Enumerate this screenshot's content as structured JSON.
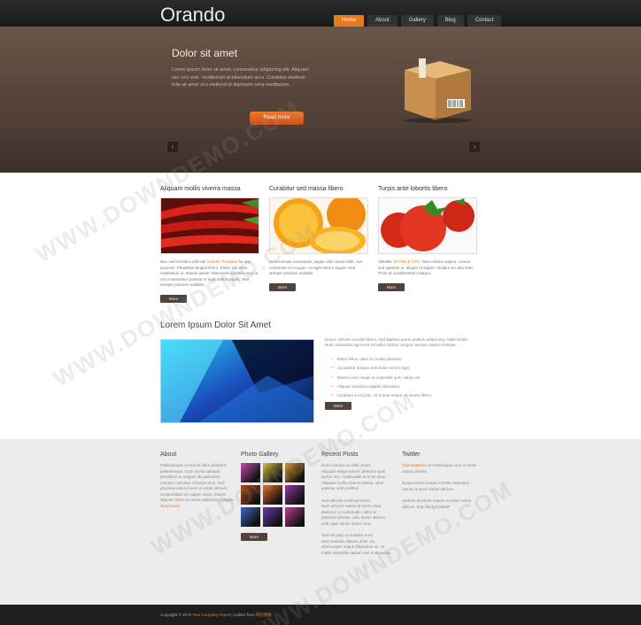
{
  "header": {
    "logo": "Orando",
    "nav": [
      "Home",
      "About",
      "Gallery",
      "Blog",
      "Contact"
    ],
    "active": "Home"
  },
  "hero": {
    "title": "Dolor sit amet",
    "text": "Lorem ipsum dolor sit amet, consectetur adipiscing elit. Aliquam nec orci erat. Vestibulum id bibendum arcu. Curabitur eleifend felis sit amet orci eleifend id dignissim urna vestibulum.",
    "button": "Read more",
    "prev": "‹",
    "next": "›"
  },
  "features": [
    {
      "title": "Aliquam mollis viverra massa",
      "text_a": "Nec nisi tincidunt wild-site ",
      "link": "Orando Template",
      "text_b": " for any purpose. Phasellus feugiat libero. Etiam nisi enim, vestibulum in. Mauris ipsum. Maecenas porttitor nunc a nisi consectetur porttitor in eget metus augue. Sed semper posuere sodales.",
      "button": "More"
    },
    {
      "title": "Curabitur sed massa libero",
      "text_a": "Al accumsan consequat, augue odio varius nibh, non commodo mi congue. Ut eget rutrum augue. Sed semper posuere sodales.",
      "link": "",
      "text_b": "",
      "button": "More"
    },
    {
      "title": "Turpis ante lobortis libero",
      "text_a": "Validate ",
      "link": "XHTML & CSS",
      "text_b": ". Nam mauris sapien, cursus sed egestas ut, aliquet ut sapien. Nullam at nulla ante. Proin at condimentum magna.",
      "button": "More"
    }
  ],
  "section": {
    "title": "Lorem Ipsum Dolor Sit Amet",
    "text": "Donec ultricies suscipit libero, sed dapibus purus pretium adipiscing. Nulla facilisi. Nunc venenatis eget erat vel tellus dictum congue suscipit magna tristique.",
    "bullets": [
      "Etiam tellus, diam ac mollis pharetra.",
      "Ut porttitor tempus erat dolor rutrum eget.",
      "Mauris justo neque ut imperdiet quis, varius vel.",
      "Aliquam tincidunt sagittis bibendum.",
      "Curabitur a mi justo. Ut a ante neque, ut ornare libero."
    ],
    "button": "More"
  },
  "footer": {
    "about": {
      "title": "About",
      "text": "Pellentesque ut erat at dolor pharetra pellentesque. Cum sociis natoque penatibus et magnis dis parturient montes, nascetur ridiculus mus. Sed pharetra varius lorem eu vitae ultrices. Suspendisse eu sapien turpis. Donec aliquam dolor eu purus adipiscing fringilla.",
      "link": "Read more"
    },
    "gallery": {
      "title": "Photo Gallery",
      "button": "More",
      "colors": [
        "#c44ab0",
        "#d4c23a",
        "#d9942c",
        "#b04a1c",
        "#e86a2a",
        "#8a3aa0",
        "#3a6ac4",
        "#6a3ab0",
        "#c43a8a"
      ]
    },
    "posts": {
      "title": "Recent Posts",
      "items": [
        {
          "date": "Duis id lectus ac nibh varius",
          "text": "Aliquam neque ipsum, pharetra quis auctor nec, malesuada et enim risus. Aliquam mollis viverra massa, vitae pulvinar velit porttitor."
        },
        {
          "date": "Sed ultricies euismod lorem",
          "text": "Nam ultricies euismod lorem vitae eleifend. Ut sollicitudin, dolor at pharetra lobortis, odio lectus ultrices velit, eget varius lorem urna."
        },
        {
          "date": "Sed vel justo ut sodales nunc",
          "text": "Sed molestie ultrices dolor, eu ullamcorper neque bibendum eu. Ut mollis imperdiet sapien non malesuada."
        }
      ]
    },
    "twitter": {
      "title": "Twitter",
      "items": [
        {
          "link": "@templatemo",
          "text": " et scelerisque urna in tortor varius ultrices."
        },
        {
          "link": "",
          "text": "Suspendisse enean XTHML Standard mauris a tortor varius ultrices."
        },
        {
          "link": "",
          "text": "Aenean tincidunt mauris in tortor varius ultrices. http://bit.ly/1XbEZF"
        }
      ]
    }
  },
  "copyright": {
    "text_a": "Copyright © 2072 ",
    "company": "Your Company Name",
    "text_b": " | Collect from ",
    "site": "网页模板"
  },
  "watermark": "WWW.DOWNDEMO.COM",
  "colors": {
    "accent": "#e67a1e",
    "hero": "#5a4639",
    "footer": "#ececec",
    "bar": "#1e1e1e"
  }
}
